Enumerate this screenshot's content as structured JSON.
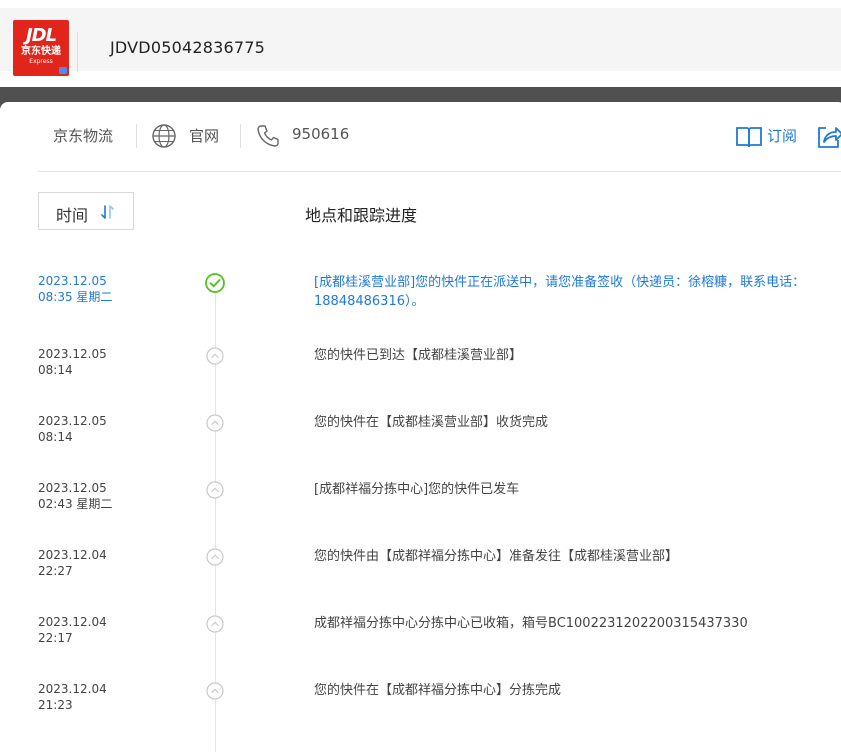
{
  "header": {
    "logo": {
      "line1": "JDL",
      "line2": "京东快递",
      "line3": "Express"
    },
    "tracking_number": "JDVD05042836775"
  },
  "info_bar": {
    "carrier": "京东物流",
    "website_label": "官网",
    "phone": "950616",
    "subscribe_label": "订阅"
  },
  "table": {
    "time_column": "时间",
    "progress_column": "地点和跟踪进度"
  },
  "events": [
    {
      "date": "2023.12.05",
      "time": "08:35 星期二",
      "message": "[成都桂溪营业部]您的快件正在派送中，请您准备签收（快递员：徐榕糠，联系电话：18848486316）。",
      "active": true
    },
    {
      "date": "2023.12.05",
      "time": "08:14",
      "message": "您的快件已到达【成都桂溪营业部】",
      "active": false
    },
    {
      "date": "2023.12.05",
      "time": "08:14",
      "message": "您的快件在【成都桂溪营业部】收货完成",
      "active": false
    },
    {
      "date": "2023.12.05",
      "time": "02:43 星期二",
      "message": "[成都祥福分拣中心]您的快件已发车",
      "active": false
    },
    {
      "date": "2023.12.04",
      "time": "22:27",
      "message": "您的快件由【成都祥福分拣中心】准备发往【成都桂溪营业部】",
      "active": false
    },
    {
      "date": "2023.12.04",
      "time": "22:17",
      "message": "成都祥福分拣中心分拣中心已收箱，箱号BC1002231202200315437330",
      "active": false
    },
    {
      "date": "2023.12.04",
      "time": "21:23",
      "message": "您的快件在【成都祥福分拣中心】分拣完成",
      "active": false
    }
  ],
  "colors": {
    "brand_red": "#e1251b",
    "accent_blue": "#1f7ad8",
    "done_green": "#52c41a"
  },
  "icons": [
    "globe-icon",
    "phone-icon",
    "subscribe-book-icon",
    "share-icon",
    "sort-icon",
    "check-circle-icon",
    "chevron-up-circle-icon"
  ]
}
